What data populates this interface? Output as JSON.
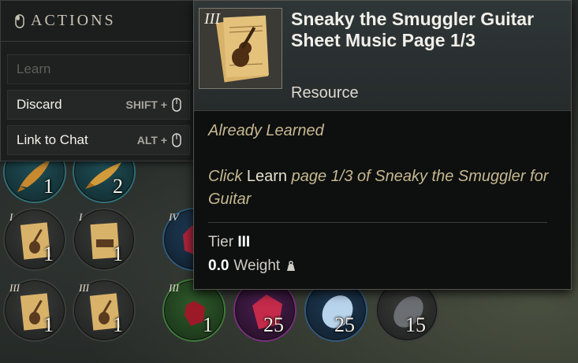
{
  "actions": {
    "title": "ACTIONS",
    "items": [
      {
        "label": "Learn",
        "modifier": "",
        "enabled": false
      },
      {
        "label": "Discard",
        "modifier": "SHIFT +",
        "enabled": true
      },
      {
        "label": "Link to Chat",
        "modifier": "ALT +",
        "enabled": true
      }
    ]
  },
  "tooltip": {
    "tier_badge": "III",
    "title": "Sneaky the Smuggler Guitar Sheet Music Page 1/3",
    "type": "Resource",
    "status": "Already Learned",
    "desc_prefix": "Click ",
    "desc_keyword": "Learn",
    "desc_suffix": " page 1/3 of Sneaky the Smuggler for Guitar",
    "tier_label": "Tier",
    "tier_value": "III",
    "weight_value": "0.0",
    "weight_label": "Weight",
    "icon": "guitar-sheet-music-icon"
  },
  "inventory": {
    "slots": [
      {
        "tier": "",
        "qty": "1",
        "icon": "fish-icon",
        "style": "teal"
      },
      {
        "tier": "",
        "qty": "2",
        "icon": "fish-icon",
        "style": "teal"
      },
      {
        "tier": "I",
        "qty": "1",
        "icon": "guitar-sheet-music-icon",
        "style": ""
      },
      {
        "tier": "I",
        "qty": "1",
        "icon": "sheet-music-icon",
        "style": ""
      },
      {
        "tier": "IV",
        "qty": "",
        "icon": "gem-icon",
        "style": "blue"
      },
      {
        "tier": "III",
        "qty": "1",
        "icon": "guitar-sheet-music-icon",
        "style": ""
      },
      {
        "tier": "III",
        "qty": "1",
        "icon": "guitar-sheet-music-icon",
        "style": ""
      },
      {
        "tier": "III",
        "qty": "1",
        "icon": "red-gem-icon",
        "style": "green"
      },
      {
        "tier": "",
        "qty": "25",
        "icon": "ruby-icon",
        "style": "purple"
      },
      {
        "tier": "",
        "qty": "25",
        "icon": "sapphire-icon",
        "style": "blue"
      },
      {
        "tier": "",
        "qty": "15",
        "icon": "onyx-icon",
        "style": ""
      }
    ]
  }
}
